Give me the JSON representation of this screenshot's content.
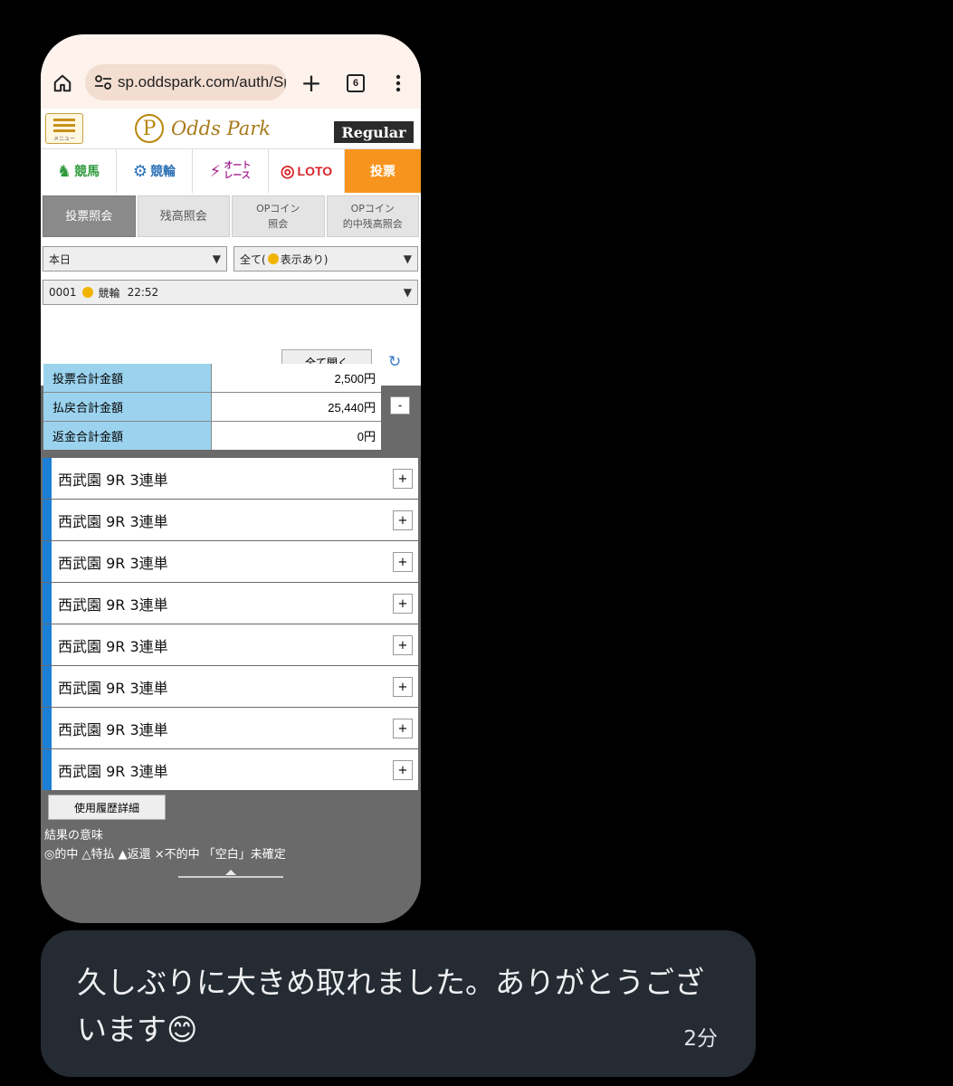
{
  "browser": {
    "url": "sp.oddspark.com/auth/Sp",
    "tab_count": "6"
  },
  "site": {
    "menu_label": "メニュー",
    "logo_text": "Odds Park",
    "plan_badge": "Regular"
  },
  "category_tabs": [
    {
      "label": "競馬",
      "color": "#2e9a3c"
    },
    {
      "label": "競輪",
      "color": "#2a6fb5"
    },
    {
      "label": "オート レース",
      "color": "#a3248f"
    },
    {
      "label": "LOTO",
      "color": "#d9252a"
    },
    {
      "label": "投票",
      "active": true
    }
  ],
  "sub_tabs": [
    {
      "label": "投票照会",
      "active": true
    },
    {
      "label": "残高照会"
    },
    {
      "line1": "OPコイン",
      "line2": "照会"
    },
    {
      "line1": "OPコイン",
      "line2": "的中残高照会"
    }
  ],
  "filters": {
    "date": "本日",
    "display_prefix": "全て(",
    "display_suffix": "表示あり)",
    "ticket_id": "0001",
    "ticket_type": "競輪",
    "ticket_time": "22:52"
  },
  "expand_all_label": "全て開く",
  "summary": [
    {
      "label": "投票合計金額",
      "value": "2,500円"
    },
    {
      "label": "払戻合計金額",
      "value": "25,440円"
    },
    {
      "label": "返金合計金額",
      "value": "0円"
    }
  ],
  "collapse_symbol": "-",
  "races": [
    "西武園 9R 3連単",
    "西武園 9R 3連単",
    "西武園 9R 3連単",
    "西武園 9R 3連単",
    "西武園 9R 3連単",
    "西武園 9R 3連単",
    "西武園 9R 3連単",
    "西武園 9R 3連単"
  ],
  "expand_symbol": "+",
  "history_button": "使用履歴詳細",
  "legend": {
    "title": "結果の意味",
    "text": "◎的中 △特払 ▲返還 ×不的中 「空白」未確定"
  },
  "message": {
    "text": "久しぶりに大きめ取れました。ありがとうございます😊",
    "time": "2分"
  }
}
